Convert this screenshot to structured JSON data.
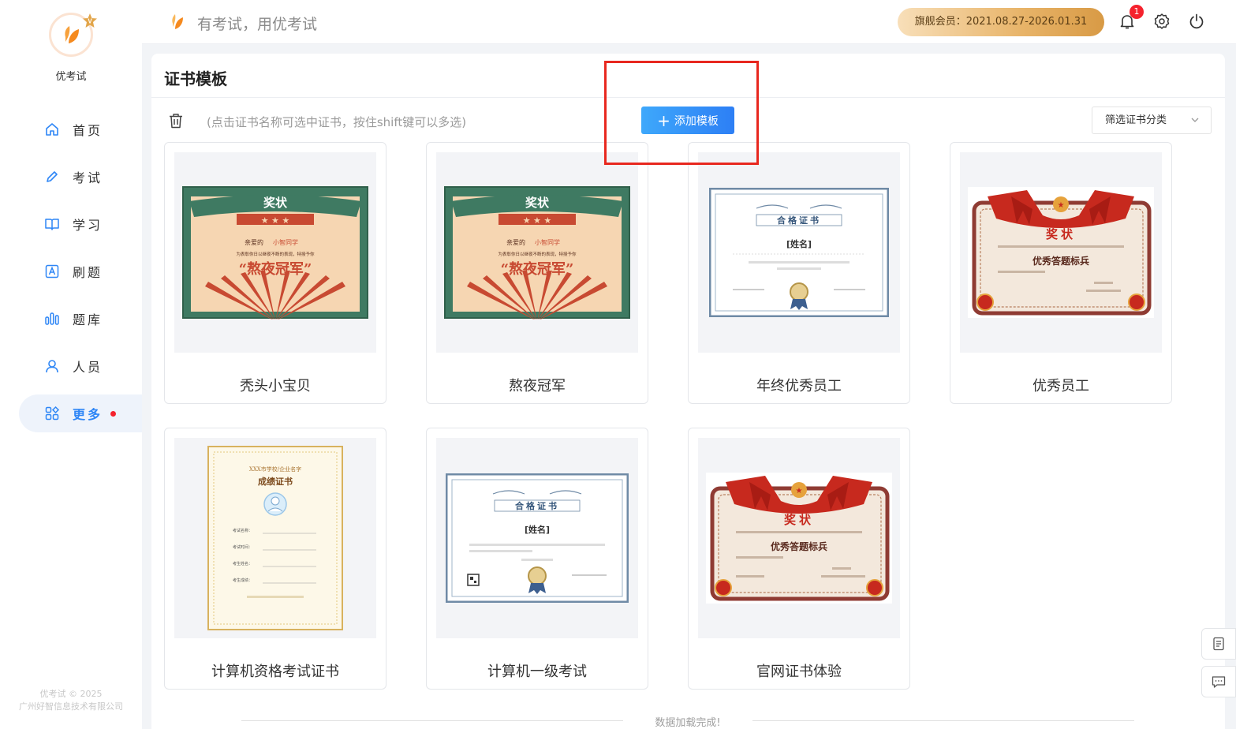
{
  "app": {
    "name": "优考试",
    "slogan": "有考试，用优考试"
  },
  "sidebar": {
    "items": [
      {
        "label": "首页",
        "icon": "home-icon"
      },
      {
        "label": "考试",
        "icon": "pencil-icon"
      },
      {
        "label": "学习",
        "icon": "book-icon"
      },
      {
        "label": "刷题",
        "icon": "letter-a-icon"
      },
      {
        "label": "题库",
        "icon": "chart-bars-icon"
      },
      {
        "label": "人员",
        "icon": "user-icon"
      },
      {
        "label": "更多",
        "icon": "apps-icon",
        "active": true
      }
    ],
    "footer_line1": "优考试 © 2025",
    "footer_line2": "广州好智信息技术有限公司"
  },
  "header": {
    "membership": "旗舰会员：2021.08.27-2026.01.31",
    "notification_count": "1"
  },
  "page": {
    "title": "证书模板",
    "hint": "(点击证书名称可选中证书，按住shift键可以多选)",
    "add_button": "添加模板",
    "filter_placeholder": "筛选证书分类",
    "loaded_text": "数据加载完成!"
  },
  "templates": [
    {
      "name": "秃头小宝贝",
      "style": "retro-award",
      "heading": "奖状",
      "greeting": "亲爱的",
      "recipient": "小智同学",
      "body": "为表彰你日以继夜不断的表现，特授予你",
      "honor": "“熬夜冠军”"
    },
    {
      "name": "熬夜冠军",
      "style": "retro-award",
      "heading": "奖状",
      "greeting": "亲爱的",
      "recipient": "小智同学",
      "body": "为表彰你日以继夜不断的表现，特授予你",
      "honor": "“熬夜冠军”"
    },
    {
      "name": "年终优秀员工",
      "style": "blue-frame",
      "heading": "合格证书",
      "placeholder_name": "[姓名]"
    },
    {
      "name": "优秀员工",
      "style": "red-ribbon",
      "heading": "奖状",
      "honor": "优秀答题标兵"
    },
    {
      "name": "计算机资格考试证书",
      "style": "gold-portrait",
      "heading": "成绩证书",
      "org": "XXX市学校/企业名字",
      "fields": [
        "考试名称：",
        "考试时间：",
        "考生姓名：",
        "考生成绩："
      ]
    },
    {
      "name": "计算机一级考试",
      "style": "blue-frame",
      "heading": "合格证书",
      "placeholder_name": "[姓名]"
    },
    {
      "name": "官网证书体验",
      "style": "red-ribbon",
      "heading": "奖状",
      "honor": "优秀答题标兵"
    }
  ],
  "colors": {
    "accent": "#2e86f6",
    "highlight": "#e8281f",
    "badge": "#f5222d"
  }
}
